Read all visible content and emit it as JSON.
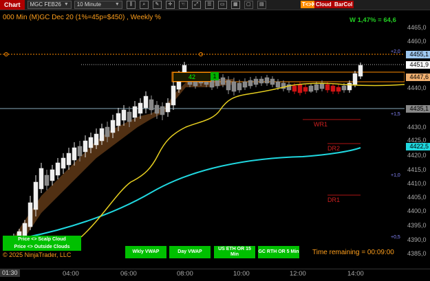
{
  "toolbar": {
    "chart_tab": "Chart",
    "instrument": "MGC FEB26",
    "interval": "10 Minute",
    "tk_label": "T<>K",
    "cloud_label": "Cloud",
    "barcol_label": "BarCol"
  },
  "chart": {
    "title": "000 Min (M)GC Dec 20 (1%=45p=$450) , Weekly %",
    "weekly": "W 1,47% = 64,6",
    "box_value": "42",
    "box_signal": "1",
    "copyright": "© 2025 NinjaTrader, LLC",
    "remaining": "Time remaining = 00:09:00",
    "current_time": "01:30"
  },
  "price_axis": {
    "labels": [
      "4465,0",
      "4460,0",
      "4445,0",
      "4440,0",
      "4430,0",
      "4425,0",
      "4420,0",
      "4415,0",
      "4410,0",
      "4405,0",
      "4400,0",
      "4395,0",
      "4390,0",
      "4385,0"
    ],
    "tags": {
      "t1": "4455,1",
      "t2": "4451,9",
      "t3": "4447,6",
      "t4": "4435,1",
      "t5": "4422,5"
    }
  },
  "time_axis": [
    "04:00",
    "06:00",
    "08:00",
    "10:00",
    "12:00",
    "14:00"
  ],
  "levels": [
    "WR1",
    "DR2",
    "DR1"
  ],
  "sig_pcts": [
    "+2,0",
    "+1,5",
    "+1,0",
    "+0,5"
  ],
  "buttons": {
    "scalp": "Price <> Scalp Cloud",
    "outside": "Price <> Outside Clouds",
    "wkly": "Wkly VWAP",
    "day": "Day VWAP",
    "us_eth": "US ETH OR 15 Min",
    "gc_rth": "GC RTH OR 5 Min"
  },
  "colors": {
    "up": "#e8e8e8",
    "down": "#d01515",
    "vwap_day": "#e8d020",
    "vwap_wkly": "#20d8e0",
    "cloud": "#5a3515",
    "accent": "#ff8c00"
  }
}
